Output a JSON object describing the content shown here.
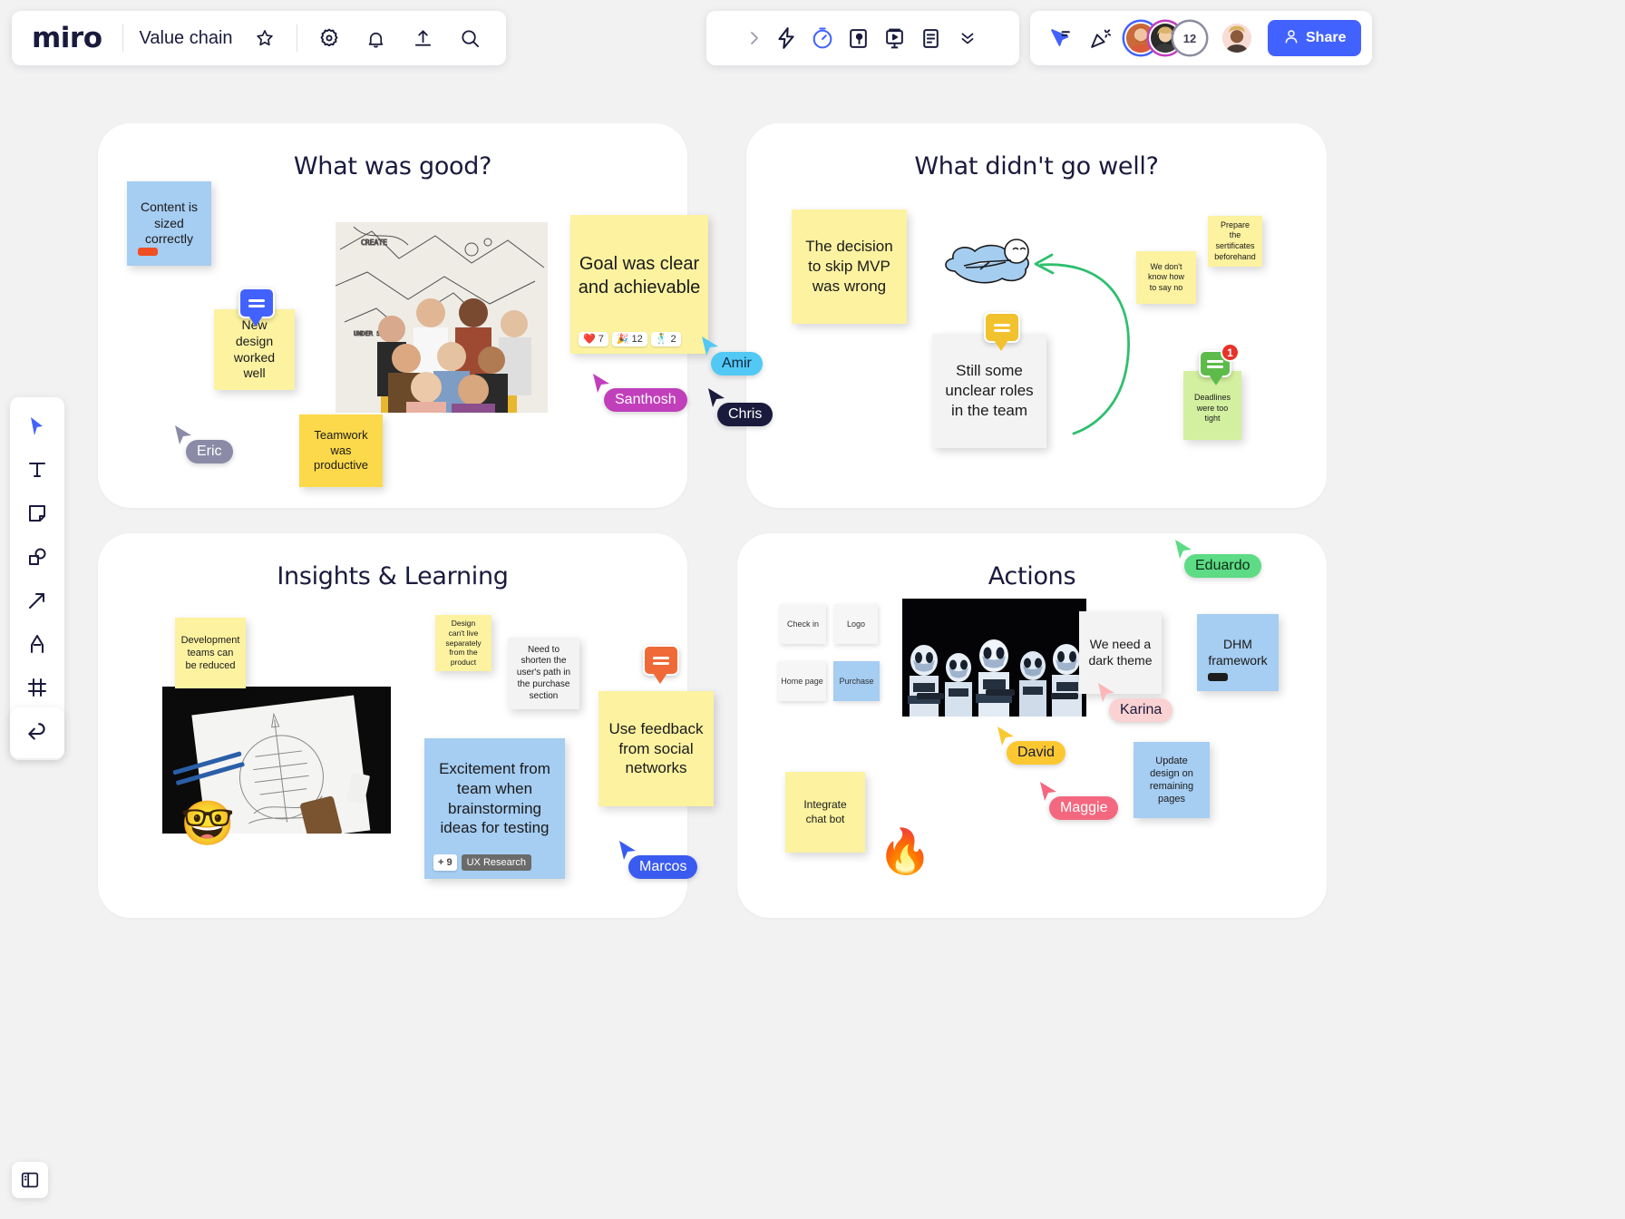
{
  "app": {
    "name": "miro",
    "board_title": "Value chain"
  },
  "topbar": {
    "star_icon": "star-icon",
    "settings_icon": "gear-icon",
    "notifications_icon": "bell-icon",
    "upload_icon": "upload-icon",
    "search_icon": "search-icon"
  },
  "centerbar": {
    "expand_icon": "chevron-right-icon",
    "items": [
      {
        "icon": "lightning-icon",
        "name": "apps-integrations"
      },
      {
        "icon": "timer-icon",
        "name": "timer"
      },
      {
        "icon": "voting-icon",
        "name": "voting"
      },
      {
        "icon": "presentation-icon",
        "name": "presentation"
      },
      {
        "icon": "notes-icon",
        "name": "notes"
      },
      {
        "icon": "chevron-double-down-icon",
        "name": "more-tools"
      }
    ]
  },
  "rightbar": {
    "cursor_chat_icon": "cursor-chat-icon",
    "celebrate_icon": "party-popper-icon",
    "collaborators": [
      {
        "name": "collaborator-1",
        "ring": "#4262ff",
        "label": ""
      },
      {
        "name": "collaborator-2",
        "ring": "#c13fbb",
        "label": ""
      },
      {
        "name": "collaborator-overflow",
        "ring": "#8c8ca1",
        "label": "12"
      }
    ],
    "current_user": {
      "name": "current-user-avatar",
      "label": ""
    },
    "share_label": "Share",
    "share_icon": "person-icon",
    "share_color": "#4262ff"
  },
  "leftbar": {
    "tools": [
      {
        "name": "select-tool",
        "icon": "cursor-arrow-icon"
      },
      {
        "name": "text-tool",
        "icon": "text-t-icon"
      },
      {
        "name": "sticky-note-tool",
        "icon": "sticky-note-icon"
      },
      {
        "name": "shapes-tool",
        "icon": "shapes-icon"
      },
      {
        "name": "connector-tool",
        "icon": "arrow-icon"
      },
      {
        "name": "pen-tool",
        "icon": "pen-icon"
      },
      {
        "name": "frame-tool",
        "icon": "frame-icon"
      },
      {
        "name": "more-tools",
        "icon": "chevron-double-right-icon"
      }
    ],
    "undo": {
      "name": "undo-tool",
      "icon": "undo-arrow-icon"
    }
  },
  "bottomleft": {
    "panel_icon": "sidebar-panel-icon"
  },
  "frames": [
    {
      "id": "good",
      "title": "What was good?"
    },
    {
      "id": "bad",
      "title": "What didn't go well?"
    },
    {
      "id": "insights",
      "title": "Insights & Learning"
    },
    {
      "id": "actions",
      "title": "Actions"
    }
  ],
  "notes": {
    "good": [
      {
        "name": "note-content-sized",
        "text": "Content is sized correctly",
        "color": "blue",
        "chip": "#f04e23"
      },
      {
        "name": "note-new-design",
        "text": "New design worked well",
        "color": "yellow"
      },
      {
        "name": "note-teamwork",
        "text": "Teamwork was productive",
        "color": "gold"
      },
      {
        "name": "note-goal-clear",
        "text": "Goal was clear and achievable",
        "color": "yellow",
        "reactions": [
          {
            "emoji": "❤️",
            "count": "7"
          },
          {
            "emoji": "🎉",
            "count": "12"
          },
          {
            "emoji": "🕺",
            "count": "2"
          }
        ]
      }
    ],
    "bad": [
      {
        "name": "note-skip-mvp",
        "text": "The decision to skip MVP was wrong",
        "color": "yellow"
      },
      {
        "name": "note-unclear-roles",
        "text": "Still some unclear roles in the team",
        "color": "white"
      },
      {
        "name": "note-say-no",
        "text": "We don't know how to say no",
        "color": "yellow"
      },
      {
        "name": "note-certificates",
        "text": "Prepare the sertificates beforehand",
        "color": "yellow"
      },
      {
        "name": "note-deadlines-tight",
        "text": "Deadlines were too tight",
        "color": "green"
      }
    ],
    "insights": [
      {
        "name": "note-dev-teams-reduced",
        "text": "Development teams can be reduced",
        "color": "yellow"
      },
      {
        "name": "note-design-separate",
        "text": "Design can't live separately from the product",
        "color": "yellow"
      },
      {
        "name": "note-shorten-path",
        "text": "Need to shorten the user's path in the purchase section",
        "color": "white"
      },
      {
        "name": "note-social-feedback",
        "text": "Use feedback from social networks",
        "color": "yellow"
      },
      {
        "name": "note-excitement",
        "text": "Excitement from team when brainstorming ideas for testing",
        "color": "blue",
        "tags": {
          "plus": "+ 9",
          "chip": "UX Research"
        }
      }
    ],
    "actions": [
      {
        "name": "note-dark-theme",
        "text": "We need a dark theme",
        "color": "white"
      },
      {
        "name": "note-dhm-framework",
        "text": "DHM framework",
        "color": "blue",
        "chip": "#1d1d1d"
      },
      {
        "name": "note-update-design",
        "text": "Update design on remaining pages",
        "color": "blue"
      },
      {
        "name": "note-chat-bot",
        "text": "Integrate chat bot",
        "color": "yellow"
      }
    ]
  },
  "minicards": [
    {
      "name": "minicard-check-in",
      "text": "Check in",
      "color": "white"
    },
    {
      "name": "minicard-logo",
      "text": "Logo",
      "color": "white"
    },
    {
      "name": "minicard-home-page",
      "text": "Home page",
      "color": "white"
    },
    {
      "name": "minicard-purchase",
      "text": "Purchase",
      "color": "blue"
    }
  ],
  "comments": [
    {
      "name": "comment-new-design",
      "color": "#4262ff",
      "badge": ""
    },
    {
      "name": "comment-unclear-roles",
      "color": "#f2c12e",
      "badge": ""
    },
    {
      "name": "comment-deadlines",
      "color": "#5dbb4b",
      "badge": "1"
    },
    {
      "name": "comment-feedback",
      "color": "#f06a38",
      "badge": ""
    }
  ],
  "cursors": [
    {
      "name": "cursor-eric",
      "label": "Eric",
      "bg": "#8b8ba7",
      "fg": "#ffffff"
    },
    {
      "name": "cursor-santhosh",
      "label": "Santhosh",
      "bg": "#c13fbb",
      "fg": "#ffffff"
    },
    {
      "name": "cursor-amir",
      "label": "Amir",
      "bg": "#52c8f5",
      "fg": "#10263d"
    },
    {
      "name": "cursor-chris",
      "label": "Chris",
      "bg": "#1a1a3d",
      "fg": "#ffffff"
    },
    {
      "name": "cursor-marcos",
      "label": "Marcos",
      "bg": "#3a5bef",
      "fg": "#ffffff"
    },
    {
      "name": "cursor-eduardo",
      "label": "Eduardo",
      "bg": "#5ddb85",
      "fg": "#0d2d17"
    },
    {
      "name": "cursor-karina",
      "label": "Karina",
      "bg": "#fbd2d2",
      "fg": "#1a1a3d"
    },
    {
      "name": "cursor-david",
      "label": "David",
      "bg": "#fbc832",
      "fg": "#1a1a3d"
    },
    {
      "name": "cursor-maggie",
      "label": "Maggie",
      "bg": "#f4687f",
      "fg": "#ffffff"
    }
  ],
  "emojis": {
    "nerd_face": "🤓",
    "fire": "🔥"
  }
}
